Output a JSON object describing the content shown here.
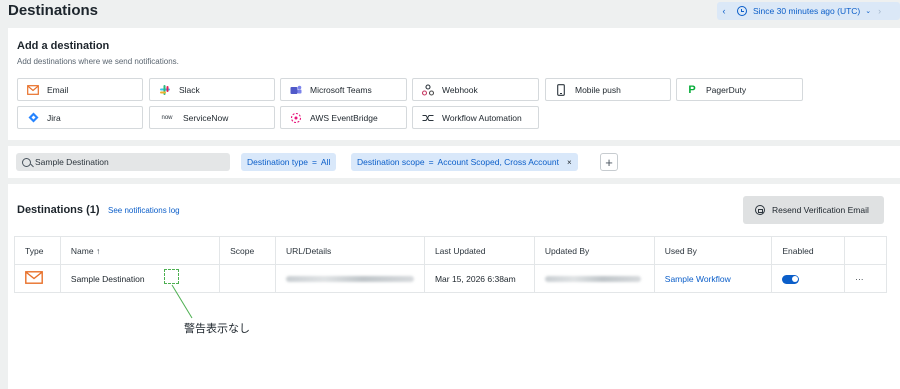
{
  "header": {
    "title": "Destinations",
    "time_range": "Since 30 minutes ago (UTC)",
    "prev_icon": "chevron-left-icon",
    "next_icon": "chevron-right-icon"
  },
  "add_destination": {
    "title": "Add a destination",
    "subtitle": "Add destinations where we send notifications.",
    "options": [
      {
        "label": "Email",
        "icon": "email-icon"
      },
      {
        "label": "Slack",
        "icon": "slack-icon"
      },
      {
        "label": "Microsoft Teams",
        "icon": "teams-icon"
      },
      {
        "label": "Webhook",
        "icon": "webhook-icon"
      },
      {
        "label": "Mobile push",
        "icon": "mobile-icon"
      },
      {
        "label": "PagerDuty",
        "icon": "pagerduty-icon"
      },
      {
        "label": "Jira",
        "icon": "jira-icon"
      },
      {
        "label": "ServiceNow",
        "icon": "servicenow-icon"
      },
      {
        "label": "AWS EventBridge",
        "icon": "eventbridge-icon"
      },
      {
        "label": "Workflow Automation",
        "icon": "workflow-icon"
      }
    ]
  },
  "filters": {
    "search_value": "Sample Destination",
    "type_chip": {
      "key": "Destination type",
      "op": "=",
      "value": "All"
    },
    "scope_chip": {
      "key": "Destination scope",
      "op": "=",
      "value": "Account Scoped, Cross Account",
      "remove": "×"
    },
    "add_label": "+"
  },
  "main": {
    "heading": "Destinations (1)",
    "log_link": "See notifications log",
    "resend_label": "Resend Verification Email",
    "columns": [
      "Type",
      "Name ↑",
      "Scope",
      "URL/Details",
      "Last Updated",
      "Updated By",
      "Used By",
      "Enabled",
      ""
    ],
    "rows": [
      {
        "type_icon": "email-icon",
        "name": "Sample Destination",
        "scope": "",
        "last_updated": "Mar 15, 2026 6:38am",
        "used_by": "Sample Workflow",
        "enabled": true,
        "actions": "···"
      }
    ]
  },
  "annotation": {
    "text": "警告表示なし",
    "color": "#4caf50"
  },
  "colors": {
    "accent": "#0b5ec9",
    "email": "#e8702a",
    "slack": "#4a154b",
    "pagerduty": "#06ac38",
    "jira": "#2684ff"
  }
}
